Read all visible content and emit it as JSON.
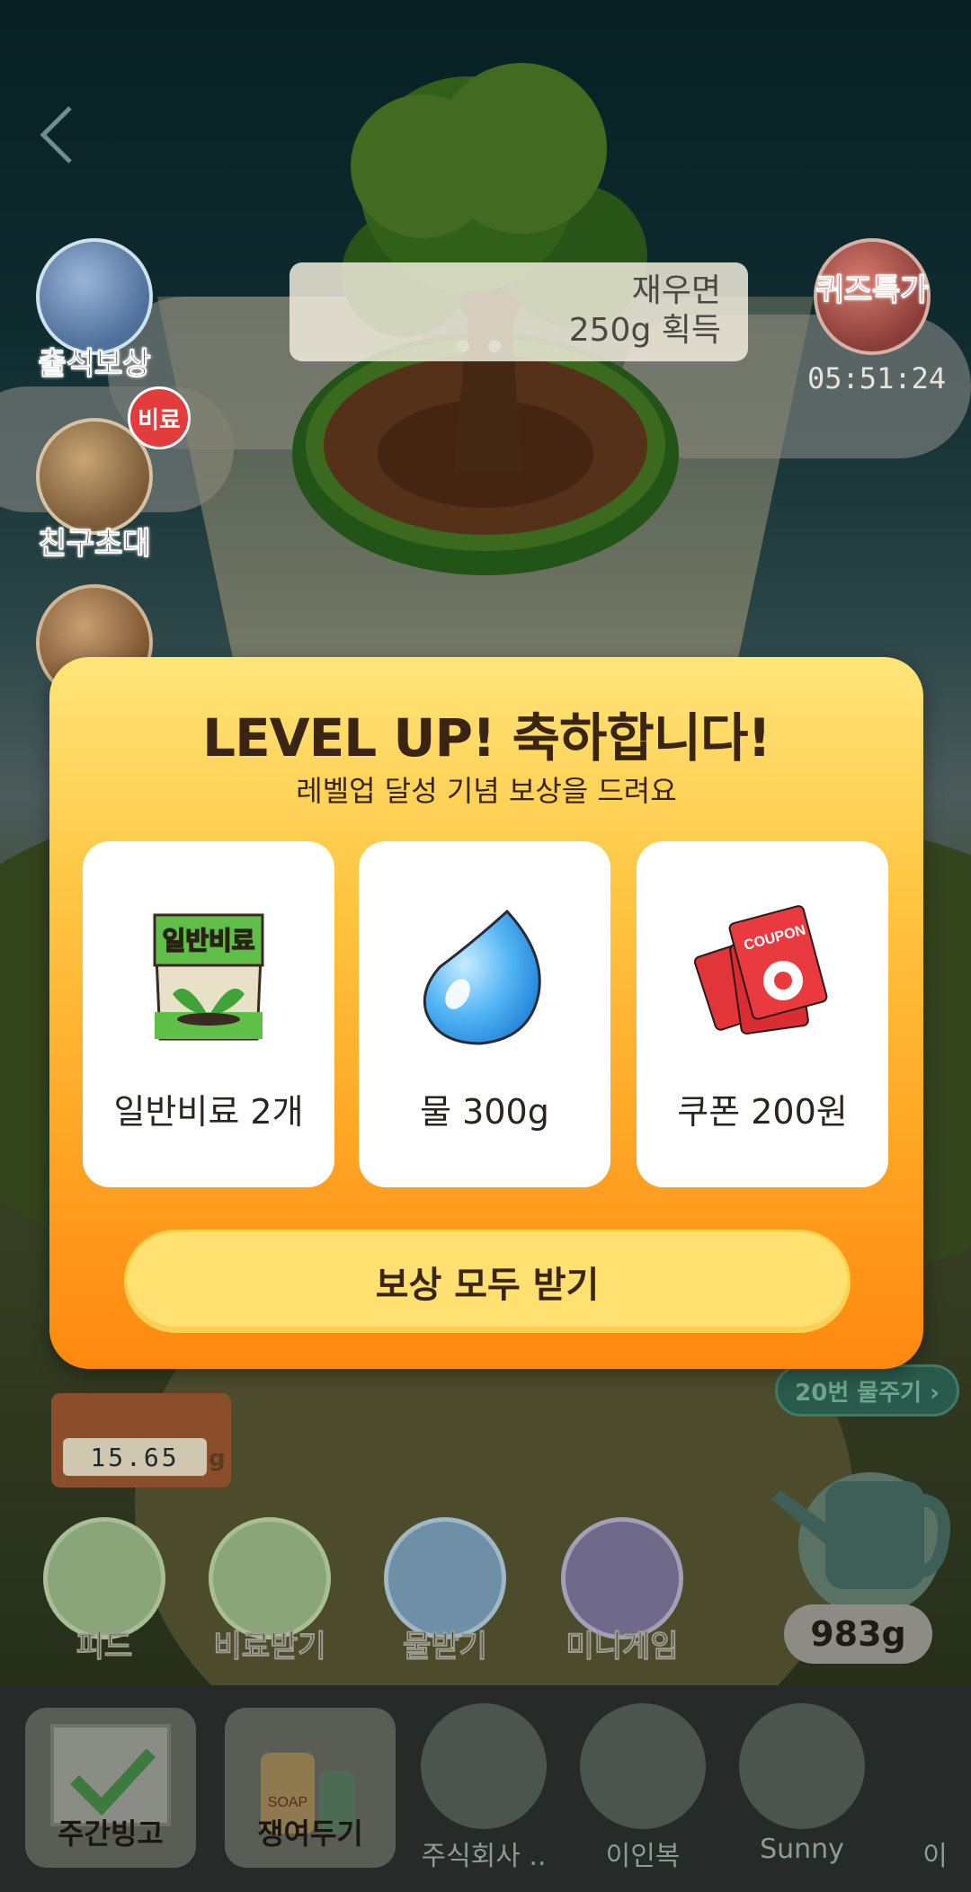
{
  "navigation": {
    "back_label": "back"
  },
  "side_menu": {
    "attendance": "출석보상",
    "invite": "친구초대",
    "invite_badge": "비료",
    "quiz": "퀴즈특가",
    "quiz_timer": "05:51:24"
  },
  "speech_bubble": {
    "line1": "재우면",
    "line2": "250g 획득"
  },
  "modal": {
    "title": "LEVEL UP! 축하합니다!",
    "subtitle": "레벨업 달성 기념 보상을 드려요",
    "rewards": [
      {
        "icon": "fertilizer-bag-icon",
        "bag_text": "일반비료",
        "label": "일반비료 2개"
      },
      {
        "icon": "water-drop-icon",
        "label": "물 300g"
      },
      {
        "icon": "coupon-icon",
        "coupon_text": "COUPON",
        "label": "쿠폰 200원"
      }
    ],
    "claim_button": "보상 모두 받기"
  },
  "water_shortcut": "20번 물주기 ›",
  "scale": {
    "value": "15.65",
    "unit": "g"
  },
  "bottom_actions": [
    {
      "label": "피드"
    },
    {
      "label": "비료받기"
    },
    {
      "label": "물받기"
    },
    {
      "label": "미니게임"
    }
  ],
  "watering_can": {
    "amount": "983g"
  },
  "tray": {
    "items": [
      {
        "label": "주간빙고"
      },
      {
        "label": "쟁여두기",
        "soap_text": "SOAP"
      },
      {
        "label": "주식회사 .."
      },
      {
        "label": "이인복"
      },
      {
        "label": "Sunny"
      },
      {
        "label": "이"
      }
    ]
  },
  "colors": {
    "modal_top": "#ffe579",
    "modal_bottom": "#ff8810",
    "button": "#ffe070",
    "title_text": "#3a2414"
  }
}
